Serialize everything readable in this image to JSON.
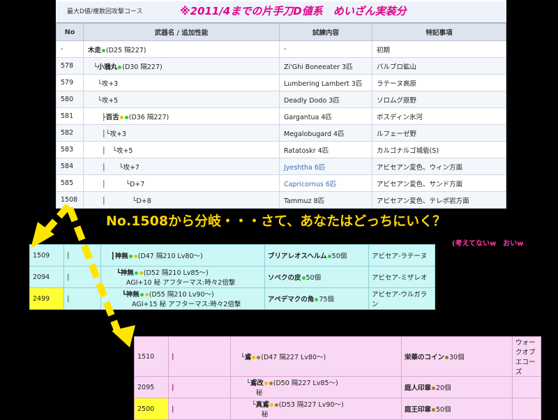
{
  "header": {
    "course": "最大D値/複数回攻撃コース",
    "headline": "※2011/4までの片手刀D値系　めいざん実装分"
  },
  "table1": {
    "columns": [
      "No",
      "武器名 / 追加性能",
      "試練内容",
      "特記事項"
    ],
    "rows": [
      {
        "no": "-",
        "weapon": "木走",
        "stats": "(D25 隔227)",
        "trial": "-",
        "note": "初期",
        "indent": 0,
        "dots": [
          "g"
        ]
      },
      {
        "no": "578",
        "weapon": "└小鴉丸",
        "stats": "(D30 隔227)",
        "trial": "Zi'Ghi Boneeater 3匹",
        "note": "パルブロ鉱山",
        "indent": 8,
        "dots": [
          "g"
        ]
      },
      {
        "no": "579",
        "weapon": "└攻+3",
        "stats": "",
        "trial": "Lumbering Lambert 3匹",
        "note": "ラテーヌ高原",
        "indent": 14,
        "dots": []
      },
      {
        "no": "580",
        "weapon": "└攻+5",
        "stats": "",
        "trial": "Deadly Dodo 3匹",
        "note": "ソロムグ原野",
        "indent": 14,
        "dots": []
      },
      {
        "no": "581",
        "weapon": "├百舌",
        "stats": "(D36 隔227)",
        "trial": "Gargantua 4匹",
        "note": "ボスディン氷河",
        "indent": 20,
        "dots": [
          "y",
          "g"
        ]
      },
      {
        "no": "582",
        "weapon": "│└攻+3",
        "stats": "",
        "trial": "Megalobugard 4匹",
        "note": "ルフェーゼ野",
        "indent": 20,
        "dots": []
      },
      {
        "no": "583",
        "weapon": "│　└攻+5",
        "stats": "",
        "trial": "Ratatoskr 4匹",
        "note": "カルゴナルゴ城砦(S)",
        "indent": 20,
        "dots": []
      },
      {
        "no": "584",
        "weapon": "│　　└攻+7",
        "stats": "",
        "trial": "Jyeshtha 6匹",
        "note": "アビセアン変色、ウィン方面",
        "indent": 20,
        "dots": [],
        "link": true
      },
      {
        "no": "585",
        "weapon": "│　　　└D+7",
        "stats": "",
        "trial": "Capricornus 6匹",
        "note": "アビセアン変色、サンド方面",
        "indent": 20,
        "dots": [],
        "link": true
      },
      {
        "no": "1508",
        "weapon": "│　　　　└D+8",
        "stats": "",
        "trial": "Tammuz 8匹",
        "note": "アビセアン変色、テレポ岩方面",
        "indent": 20,
        "dots": []
      }
    ]
  },
  "banner": "No.1508から分岐・・・さて、あなたはどっちにいく？",
  "note": "(考えてないw　おいw",
  "table2": {
    "rows": [
      {
        "no": "1509",
        "weapon": "┃神無",
        "stats": "(D47 隔210 Lv80～)",
        "sub": "",
        "item": "ブリアレオスヘルム",
        "count": "50個",
        "place": "アビセア-ラテーヌ",
        "dots": [
          "g",
          "y"
        ],
        "idot": "g",
        "yellow": false
      },
      {
        "no": "2094",
        "weapon": "┗神無",
        "stats": "(D52 隔210 Lv85～)",
        "sub": "AGI+10 秘 アフターマス:時々2倍撃",
        "item": "ソベクの皮",
        "count": "50個",
        "place": "アビセア-ミザレオ",
        "dots": [
          "g",
          "y"
        ],
        "idot": "g",
        "yellow": false
      },
      {
        "no": "2499",
        "weapon": "┗神無",
        "stats": "(D55 隔210 Lv90～)",
        "sub": "AGI+15 秘 アフターマス:時々2倍撃",
        "item": "アペデマクの角",
        "count": "75個",
        "place": "アビセア-ウルガラン",
        "dots": [
          "g",
          "y"
        ],
        "idot": "g",
        "yellow": true
      }
    ]
  },
  "table3": {
    "rows": [
      {
        "no": "1510",
        "weapon": "└鳶",
        "stats": "(D47 隔227 Lv80～)",
        "sub": "",
        "item": "栄華のコイン",
        "count": "30個",
        "place": "ウォークオブエコーズ",
        "dots": [
          "y",
          "br"
        ],
        "idot": "br",
        "yellow": false
      },
      {
        "no": "2095",
        "weapon": "└鳶改",
        "stats": "(D50 隔227 Lv85～)",
        "sub": "秘",
        "item": "庭人印章",
        "count": "20個",
        "place": "",
        "dots": [
          "y",
          "br"
        ],
        "idot": "br",
        "yellow": false
      },
      {
        "no": "2500",
        "weapon": "└真鳶",
        "stats": "(D53 隔227 Lv90～)",
        "sub": "秘",
        "item": "庭王印章",
        "count": "50個",
        "place": "",
        "dots": [
          "y",
          "br"
        ],
        "idot": "br",
        "yellow": true
      }
    ]
  },
  "colors": {
    "accent_pink": "#e3008a",
    "banner_yellow": "#ffd600",
    "cyan_bg": "#ccf7f7",
    "pink_bg": "#f9d8f4"
  }
}
